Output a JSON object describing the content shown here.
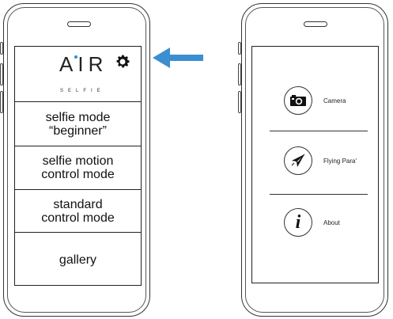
{
  "left_screen": {
    "logo": {
      "main": "AIR",
      "sub": "SELFIE"
    },
    "menu": [
      {
        "label": "selfie mode\n“beginner”"
      },
      {
        "label": "selfie motion\ncontrol mode"
      },
      {
        "label": "standard\ncontrol mode"
      },
      {
        "label": "gallery"
      }
    ]
  },
  "annotation": {
    "arrow_color": "#3b8fd0"
  },
  "right_screen": {
    "items": [
      {
        "label": "Camera",
        "icon": "camera-icon"
      },
      {
        "label": "Flying Para'",
        "icon": "paper-plane-icon"
      },
      {
        "label": "About",
        "icon": "info-icon"
      }
    ]
  },
  "colors": {
    "logo_dot": "#2b8fd6",
    "outline": "#222222"
  }
}
